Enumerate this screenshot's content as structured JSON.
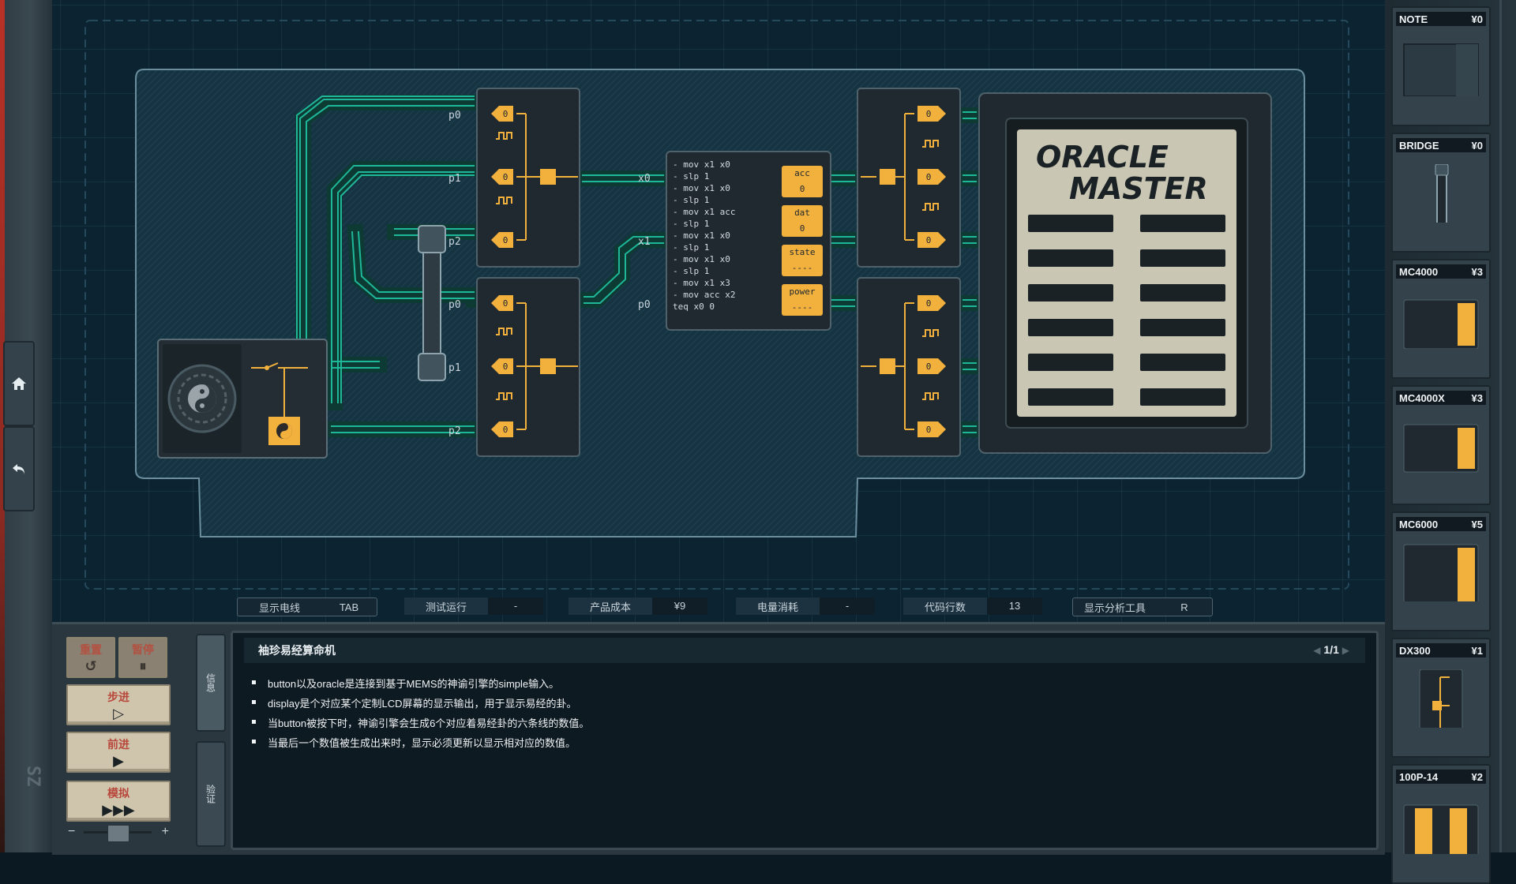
{
  "game": {
    "title_logo": "ORACLE MASTER",
    "board": {
      "port_labels": [
        "p0",
        "p1",
        "p2",
        "p0",
        "p1",
        "p2",
        "x0",
        "x1",
        "p0"
      ],
      "mc_code": [
        "- mov x1 x0",
        "- slp 1",
        "- mov x1 x0",
        "- slp 1",
        "- mov x1 acc",
        "- slp 1",
        "- mov x1 x0",
        "- slp 1",
        "- mov x1 x0",
        "- slp 1",
        "- mov x1 x3",
        "- mov acc x2",
        "  teq x0 0"
      ],
      "registers": [
        {
          "name": "acc",
          "value": "0"
        },
        {
          "name": "dat",
          "value": "0"
        },
        {
          "name": "state",
          "value": "----"
        },
        {
          "name": "power",
          "value": "----"
        }
      ],
      "dx_value": "0"
    }
  },
  "stats": [
    {
      "label": "显示电线",
      "value": "TAB"
    },
    {
      "label": "测试运行",
      "value": "-"
    },
    {
      "label": "产品成本",
      "value": "¥9"
    },
    {
      "label": "电量消耗",
      "value": "-"
    },
    {
      "label": "代码行数",
      "value": "13"
    },
    {
      "label": "显示分析工具",
      "value": "R"
    }
  ],
  "controls": {
    "reset": {
      "label": "重置",
      "glyph": "↺"
    },
    "pause": {
      "label": "暂停",
      "glyph": "⏸"
    },
    "step": {
      "label": "步进",
      "glyph": "▷"
    },
    "advance": {
      "label": "前进",
      "glyph": "▶"
    },
    "simulate": {
      "label": "模拟",
      "glyph": "▶▶▶"
    },
    "speed_minus": "−",
    "speed_plus": "+"
  },
  "tabs": {
    "info": "信息",
    "verify": "验证"
  },
  "info": {
    "title": "袖珍易经算命机",
    "page": "1/1",
    "items": [
      "button以及oracle是连接到基于MEMS的神谕引擎的simple输入。",
      "display是个对应某个定制LCD屏幕的显示输出，用于显示易经的卦。",
      "当button被按下时，神谕引擎会生成6个对应着易经卦的六条线的数值。",
      "当最后一个数值被生成出来时，显示必须更新以显示相对应的数值。"
    ]
  },
  "palette": [
    {
      "name": "NOTE",
      "price": "¥0"
    },
    {
      "name": "BRIDGE",
      "price": "¥0"
    },
    {
      "name": "MC4000",
      "price": "¥3"
    },
    {
      "name": "MC4000X",
      "price": "¥3"
    },
    {
      "name": "MC6000",
      "price": "¥5"
    },
    {
      "name": "DX300",
      "price": "¥1"
    },
    {
      "name": "100P-14",
      "price": "¥2"
    }
  ],
  "icons": {
    "home": "home-icon",
    "undo": "undo-icon",
    "yin_yang": "yin-yang-icon",
    "pulse": "pulse-icon"
  },
  "colors": {
    "wire": "#1fb79a",
    "chip_orange": "#f2b03d",
    "board_bg": "#0c2431",
    "lcd_bg": "#c9c7b4"
  }
}
